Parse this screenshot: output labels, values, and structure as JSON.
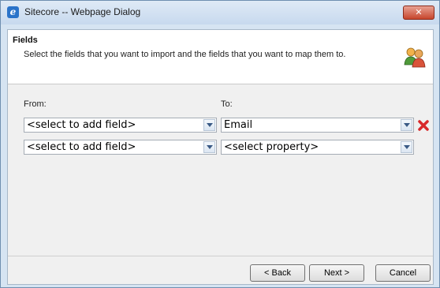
{
  "window": {
    "title": "Sitecore -- Webpage Dialog",
    "close_glyph": "✕"
  },
  "header": {
    "title": "Fields",
    "description": "Select the fields that you want to import and the fields that you want to map them to.",
    "icon": "users-icon"
  },
  "columns": {
    "from_label": "From:",
    "to_label": "To:"
  },
  "rows": [
    {
      "from": "<select to add field>",
      "to": "Email",
      "removable": true
    },
    {
      "from": "<select to add field>",
      "to": "<select property>",
      "removable": false
    }
  ],
  "buttons": {
    "back": "< Back",
    "next": "Next >",
    "cancel": "Cancel"
  },
  "colors": {
    "close_red": "#c7452c",
    "remove_red": "#d8282b",
    "title_bar": "#c7d9ee"
  }
}
